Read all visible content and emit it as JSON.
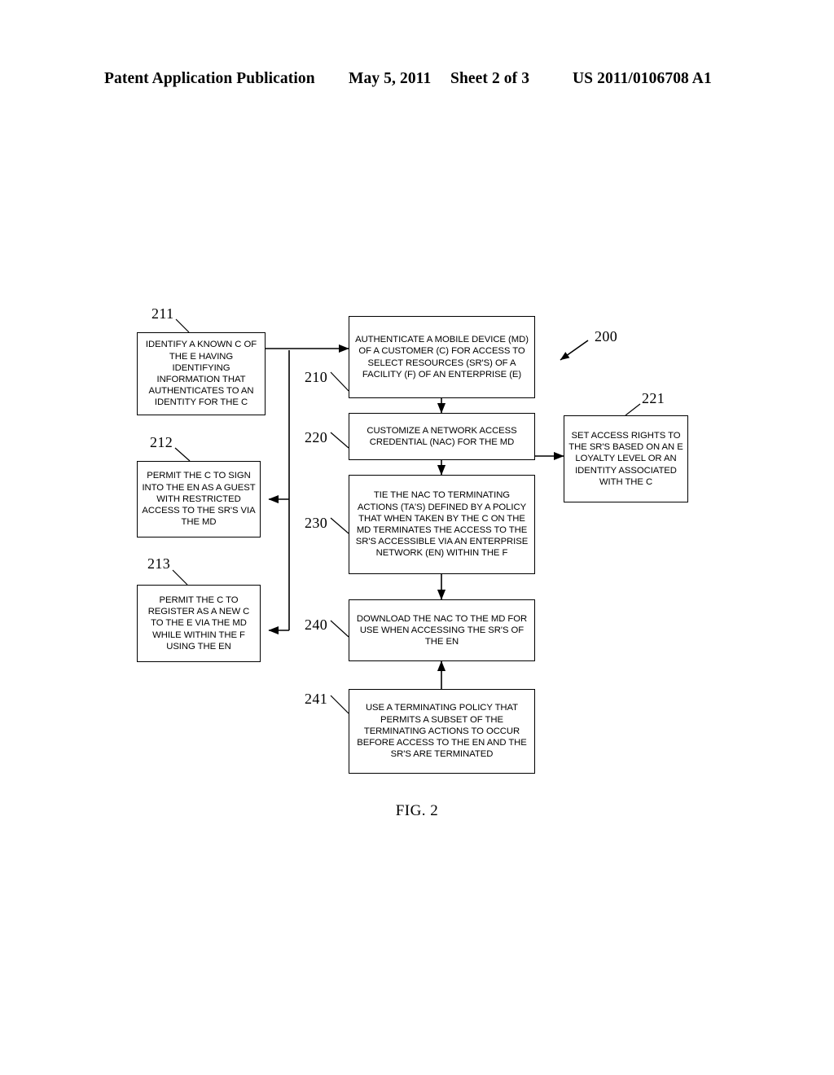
{
  "header": {
    "publication": "Patent Application Publication",
    "date": "May 5, 2011",
    "sheet": "Sheet 2 of 3",
    "patent_number": "US 2011/0106708 A1"
  },
  "figure": {
    "caption": "FIG. 2",
    "diagram_ref": "200"
  },
  "nodes": [
    {
      "ref": "211",
      "text": "IDENTIFY A KNOWN C OF THE E HAVING IDENTIFYING INFORMATION THAT AUTHENTICATES TO AN IDENTITY FOR THE C"
    },
    {
      "ref": "212",
      "text": "PERMIT THE C TO SIGN INTO THE EN AS A GUEST WITH RESTRICTED ACCESS TO THE SR'S VIA THE MD"
    },
    {
      "ref": "213",
      "text": "PERMIT THE C TO REGISTER AS A NEW C TO THE E VIA THE MD WHILE WITHIN THE F USING THE EN"
    },
    {
      "ref": "210",
      "text": "AUTHENTICATE A MOBILE DEVICE (MD) OF A CUSTOMER (C) FOR ACCESS TO SELECT RESOURCES (SR'S) OF A FACILITY (F) OF AN ENTERPRISE (E)"
    },
    {
      "ref": "220",
      "text": "CUSTOMIZE A NETWORK ACCESS CREDENTIAL (NAC) FOR THE MD"
    },
    {
      "ref": "221",
      "text": "SET ACCESS RIGHTS TO THE SR'S BASED ON AN E LOYALTY LEVEL OR AN IDENTITY ASSOCIATED WITH THE C"
    },
    {
      "ref": "230",
      "text": "TIE THE NAC TO TERMINATING ACTIONS (TA'S) DEFINED BY A POLICY THAT WHEN TAKEN BY THE C ON THE MD TERMINATES THE ACCESS TO THE SR'S ACCESSIBLE VIA AN ENTERPRISE NETWORK (EN) WITHIN THE F"
    },
    {
      "ref": "240",
      "text": "DOWNLOAD THE NAC TO THE MD FOR USE WHEN ACCESSING THE SR'S OF THE EN"
    },
    {
      "ref": "241",
      "text": "USE A TERMINATING POLICY THAT PERMITS A SUBSET OF THE TERMINATING ACTIONS TO OCCUR BEFORE ACCESS TO THE EN AND THE SR'S ARE TERMINATED"
    }
  ]
}
